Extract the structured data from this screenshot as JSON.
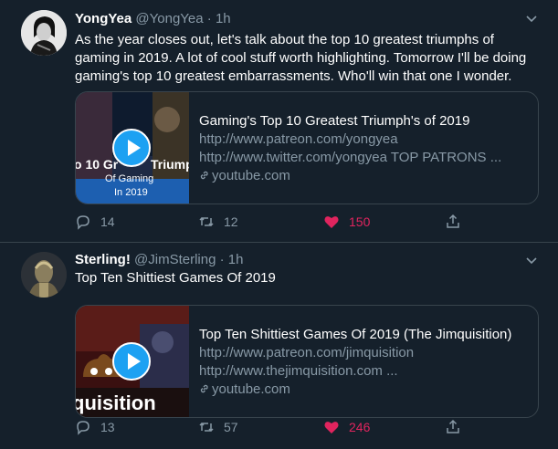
{
  "colors": {
    "background": "#15202b",
    "muted": "#8899a6",
    "like": "#e0245e",
    "accent": "#1da1f2",
    "border": "#38444d"
  },
  "tweets": [
    {
      "name": "YongYea",
      "handle": "@YongYea",
      "dot": "·",
      "time": "1h",
      "text": "As the year closes out, let's talk about the top 10 greatest triumphs of gaming in 2019. A lot of cool stuff worth highlighting. Tomorrow I'll be doing gaming's top 10 greatest embarrassments. Who'll win that one I wonder.",
      "card": {
        "thumb_text": [
          "o 10 Gr",
          "Triump",
          "Of Gaming",
          "In 2019"
        ],
        "title": "Gaming's Top 10 Greatest Triumph's of 2019",
        "line1": "http://www.patreon.com/yongyea",
        "line2": "http://www.twitter.com/yongyea TOP PATRONS ...",
        "domain": "youtube.com"
      },
      "replies": "14",
      "retweets": "12",
      "likes": "150"
    },
    {
      "name": "Sterling!",
      "handle": "@JimSterling",
      "dot": "·",
      "time": "1h",
      "text": "Top Ten Shittiest Games Of 2019",
      "card": {
        "thumb_text": [
          "quisition"
        ],
        "title": "Top Ten Shittiest Games Of 2019 (The Jimquisition)",
        "line1": "http://www.patreon.com/jimquisition",
        "line2": "http://www.thejimquisition.com ...",
        "domain": "youtube.com"
      },
      "replies": "13",
      "retweets": "57",
      "likes": "246"
    }
  ],
  "icons": [
    "chevron-down-icon",
    "play-icon",
    "link-icon",
    "reply-icon",
    "retweet-icon",
    "heart-icon",
    "share-icon"
  ]
}
